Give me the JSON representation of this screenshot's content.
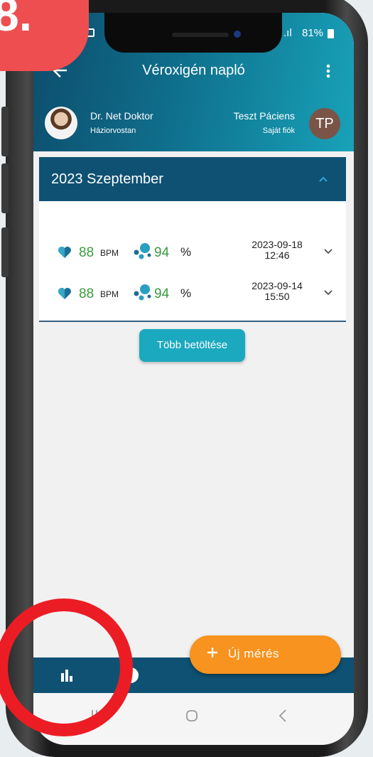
{
  "overlay": {
    "step_label": "8."
  },
  "status_bar": {
    "signal": ".ıl",
    "battery": "81%"
  },
  "app_bar": {
    "title": "Véroxigén napló"
  },
  "doctor": {
    "name": "Dr. Net Doktor",
    "role": "Háziorvostan"
  },
  "patient": {
    "name": "Teszt Páciens",
    "account": "Saját fiók",
    "initials": "TP"
  },
  "month_section": {
    "label": "2023 Szeptember",
    "measurements": [
      {
        "bpm": "88",
        "bpm_unit": "BPM",
        "spo2": "94",
        "spo2_unit": "%",
        "date": "2023-09-18",
        "time": "12:46"
      },
      {
        "bpm": "88",
        "bpm_unit": "BPM",
        "spo2": "94",
        "spo2_unit": "%",
        "date": "2023-09-14",
        "time": "15:50"
      }
    ]
  },
  "load_more_label": "Több betöltése",
  "fab_label": "Új mérés",
  "colors": {
    "header": "#0f5173",
    "accent": "#1ba9bf",
    "fab": "#f7931e",
    "value_green": "#3a9a3f",
    "highlight": "#ec1c24"
  },
  "icons": [
    "back-arrow-icon",
    "more-vert-icon",
    "heart-icon",
    "oxygen-drops-icon",
    "chevron-down-icon",
    "chevron-up-icon",
    "bar-chart-icon",
    "plus-icon",
    "recents-icon",
    "home-icon",
    "back-icon"
  ]
}
